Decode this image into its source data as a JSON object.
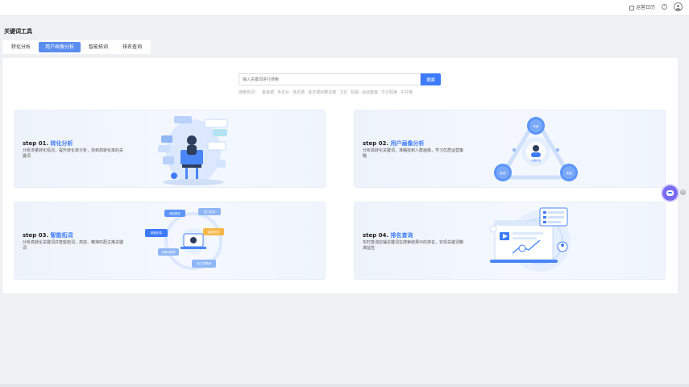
{
  "topbar": {
    "calendar_label": "运营日历",
    "help_icon": "?"
  },
  "page_title": "关键词工具",
  "tabs": [
    {
      "label": "转化分析",
      "active": false
    },
    {
      "label": "用户画像分析",
      "active": true
    },
    {
      "label": "智能拓词",
      "active": false
    },
    {
      "label": "排名查询",
      "active": false
    }
  ],
  "search": {
    "placeholder": "输入关键词进行搜索",
    "button_label": "搜索"
  },
  "hot_words": [
    "搜索热词：",
    "夏装裙",
    "毛衣女",
    "连衣裙",
    "连衣裙收腰显瘦",
    "卫衣",
    "短袖",
    "运动套装",
    "牛仔短裤",
    "牛仔裤"
  ],
  "cards": [
    {
      "step": "step 01.",
      "name": "转化分析",
      "desc": "分析流量转化情况，提升转化率分析，找到高转化率的关键词"
    },
    {
      "step": "step 02.",
      "name": "用户画像分析",
      "desc": "分析高转化关键词，准确找到人群画像，学习优质运营策略"
    },
    {
      "step": "step 03.",
      "name": "智能拓词",
      "desc": "分析高转化关键词并智能拓词，高效、精准匹配主推关键词"
    },
    {
      "step": "step 04.",
      "name": "排名查询",
      "desc": "实时查询店铺关键词在搜索结果中的排名，实现关键词精准监控"
    }
  ],
  "illustration_labels": {
    "c2": [
      "年龄",
      "兴趣标签",
      "地域",
      "性别"
    ],
    "c3": [
      "商品属性",
      "热门拓词",
      "智能拓词",
      "精准拓词",
      "长尾词推荐",
      "热门词联想"
    ]
  },
  "colors": {
    "accent": "#3e7bfa",
    "tab_active": "#5b8def",
    "card_bg": "#eef3fb"
  }
}
